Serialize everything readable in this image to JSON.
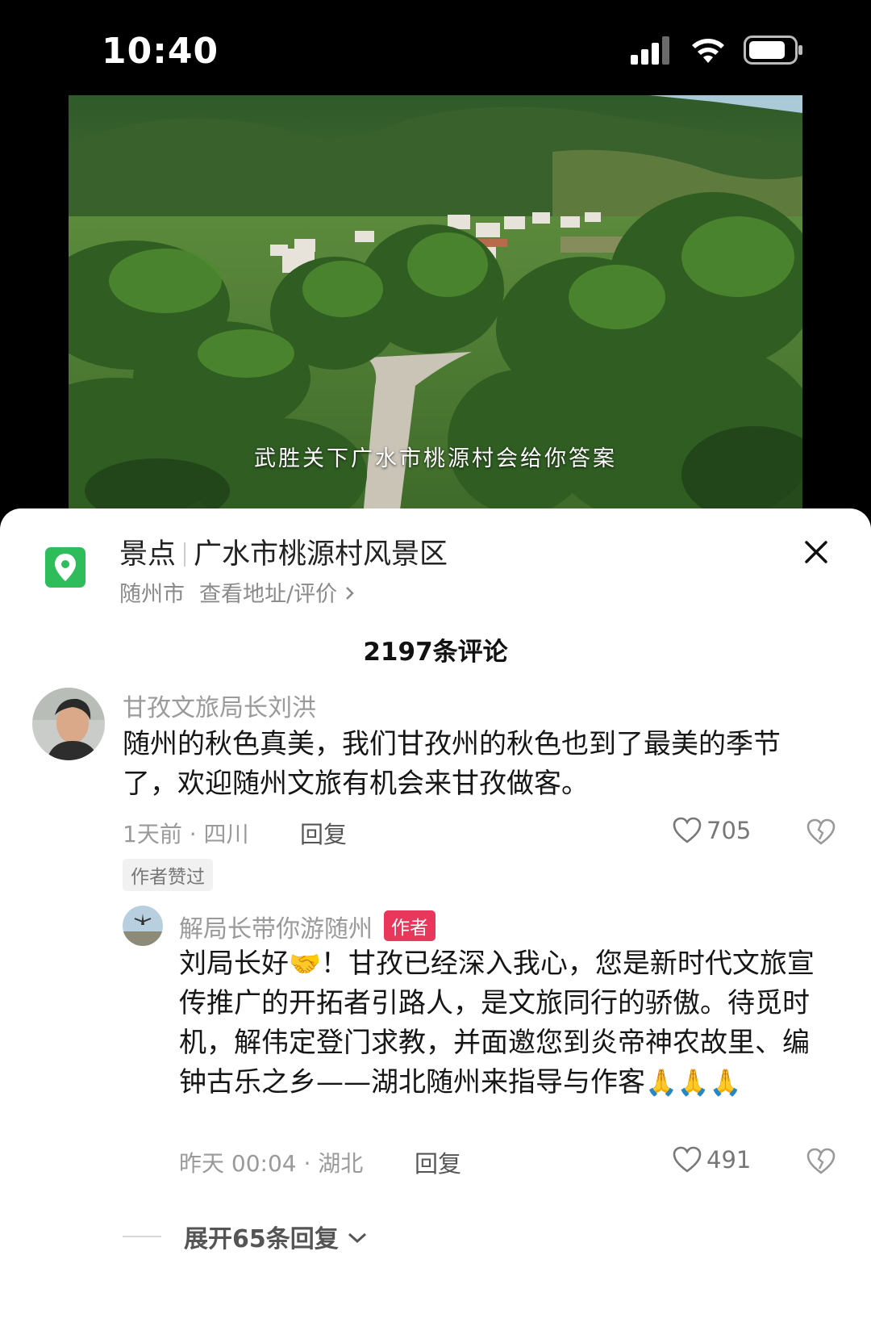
{
  "status_bar": {
    "time": "10:40",
    "icons": [
      "signal-icon",
      "wifi-icon",
      "battery-icon"
    ]
  },
  "video": {
    "subtitle": "武胜关下广水市桃源村会给你答案"
  },
  "poi": {
    "icon": "location-pin-icon",
    "category": "景点",
    "name": "广水市桃源村风景区",
    "city": "随州市",
    "link_label": "查看地址/评价",
    "close_icon": "close-icon"
  },
  "comments_header": {
    "count_label": "2197条评论"
  },
  "comments": [
    {
      "name": "甘孜文旅局长刘洪",
      "text": "随州的秋色真美，我们甘孜州的秋色也到了最美的季节了，欢迎随州文旅有机会来甘孜做客。",
      "meta": "1天前 · 四川",
      "reply_label": "回复",
      "likes": "705",
      "badge": "作者赞过"
    }
  ],
  "replies": [
    {
      "name": "解局长带你游随州",
      "author_badge": "作者",
      "text_part1": "刘局长好",
      "emoji1": "🤝",
      "text_part2": "！甘孜已经深入我心，您是新时代文旅宣传推广的开拓者引路人，是文旅同行的骄傲。待觅时机，解伟定登门求教，并面邀您到炎帝神农故里、编钟古乐之乡——湖北随州来指导与作客",
      "emoji2": "🙏🙏🙏",
      "meta": "昨天 00:04 · 湖北",
      "reply_label": "回复",
      "likes": "491"
    }
  ],
  "expand": {
    "label": "展开65条回复"
  },
  "colors": {
    "pin_green": "#2fbd5c",
    "author_badge": "#e8375a"
  }
}
